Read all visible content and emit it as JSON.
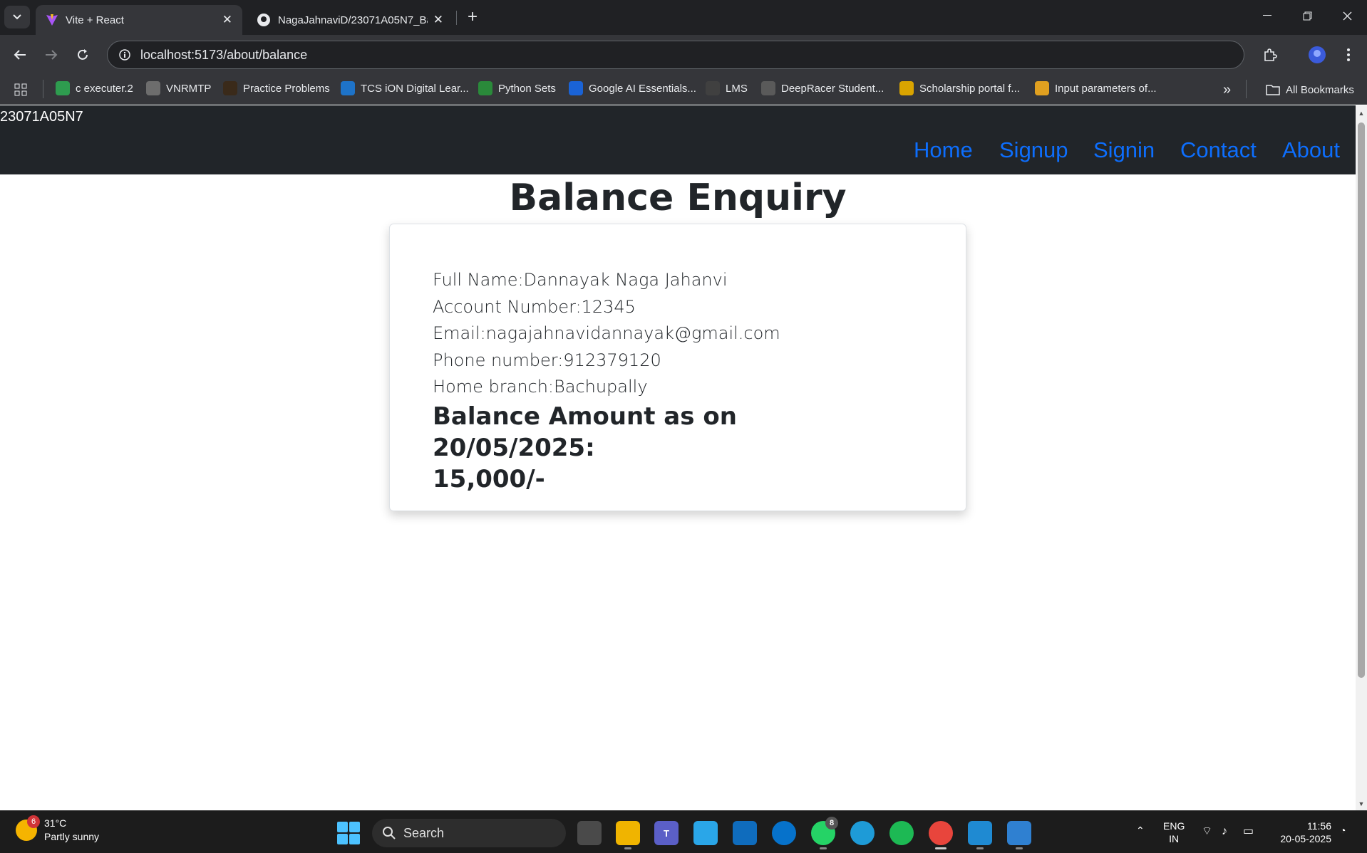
{
  "browser": {
    "tabs": [
      {
        "title": "Vite + React",
        "active": true
      },
      {
        "title": "NagaJahnaviD/23071A05N7_Ba",
        "active": false
      }
    ],
    "url": "localhost:5173/about/balance",
    "bookmarks": [
      {
        "label": "c executer.2",
        "color": "#2e9c4f"
      },
      {
        "label": "VNRMTP",
        "color": "#6d6d6d"
      },
      {
        "label": "Practice Problems",
        "color": "#3a2a1a"
      },
      {
        "label": "TCS iON Digital Lear...",
        "color": "#1e73c8"
      },
      {
        "label": "Python Sets",
        "color": "#2a8a3a"
      },
      {
        "label": "Google AI Essentials...",
        "color": "#1a63d6"
      },
      {
        "label": "LMS",
        "color": "#404040"
      },
      {
        "label": "DeepRacer Student...",
        "color": "#5a5a5a"
      },
      {
        "label": "Scholarship portal f...",
        "color": "#d9a400"
      },
      {
        "label": "Input parameters of...",
        "color": "#e0a020"
      }
    ],
    "all_bookmarks_label": "All Bookmarks"
  },
  "app": {
    "brand": "23071A05N7",
    "nav": [
      "Home",
      "Signup",
      "Signin",
      "Contact",
      "About"
    ],
    "page_title": "Balance Enquiry",
    "details": {
      "full_name": "Full Name:Dannayak Naga Jahanvi",
      "account_number": "Account Number:12345",
      "email": "Email:nagajahnavidannayak@gmail.com",
      "phone": "Phone number:912379120",
      "home_branch": "Home branch:Bachupally"
    },
    "balance_line1": "Balance Amount as on 20/05/2025:",
    "balance_line2": "15,000/-"
  },
  "taskbar": {
    "weather_temp": "31°C",
    "weather_desc": "Partly sunny",
    "weather_badge": "6",
    "search_label": "Search",
    "whatsapp_badge": "8",
    "lang_line1": "ENG",
    "lang_line2": "IN",
    "time": "11:56",
    "date": "20-05-2025"
  }
}
